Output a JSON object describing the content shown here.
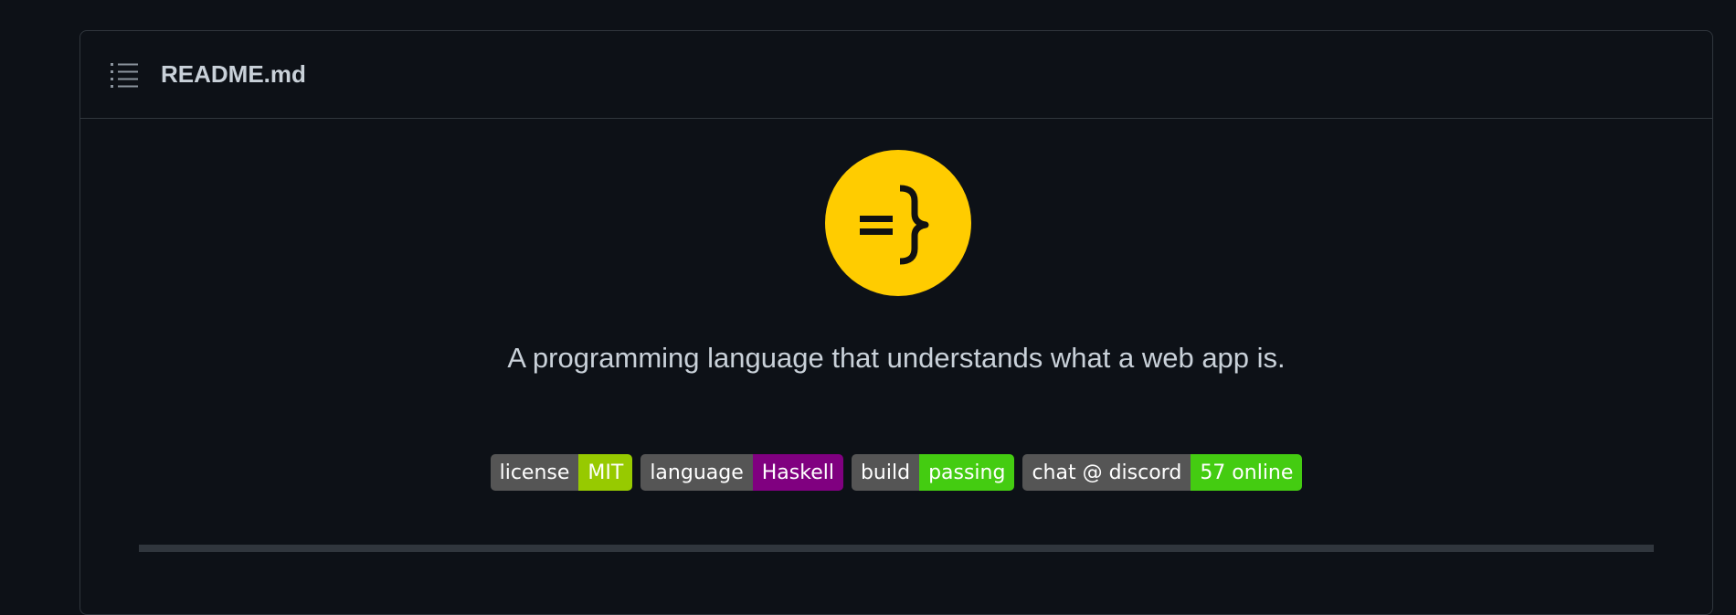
{
  "readme": {
    "file_name": "README.md",
    "logo_text": "=}",
    "tagline": "A programming language that understands what a web app is."
  },
  "badges": [
    {
      "label": "license",
      "message": "MIT",
      "color": "#97ca00"
    },
    {
      "label": "language",
      "message": "Haskell",
      "color": "#800080"
    },
    {
      "label": "build",
      "message": "passing",
      "color": "#44cc11"
    },
    {
      "label": "chat @ discord",
      "message": "57 online",
      "color": "#44cc11"
    }
  ],
  "colors": {
    "background": "#0d1117",
    "border": "#30363d",
    "text": "#c9d1d9",
    "logo_bg": "#ffcc00",
    "badge_label_bg": "#555555"
  },
  "icons": {
    "outline": "list-unordered-icon"
  }
}
